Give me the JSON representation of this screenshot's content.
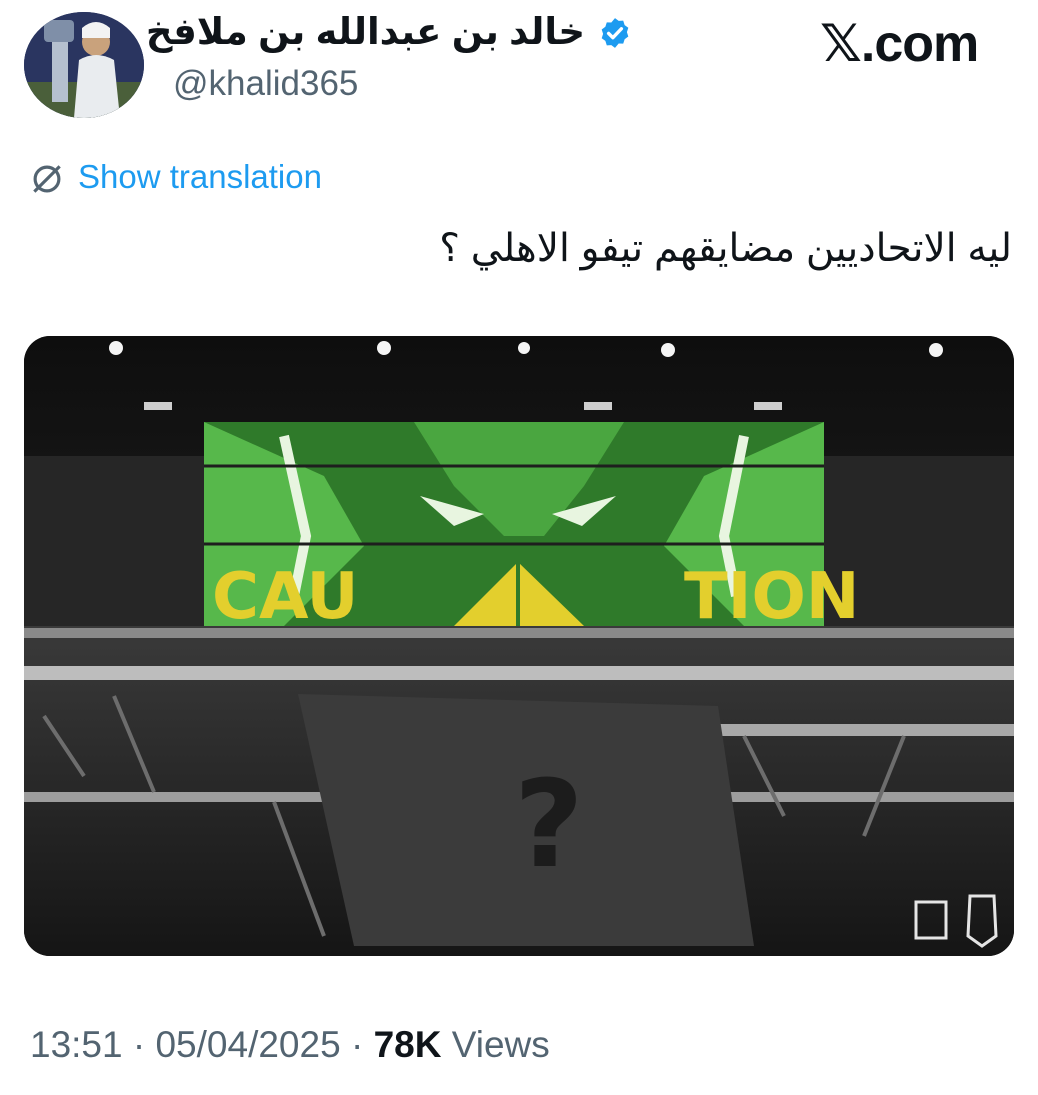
{
  "author": {
    "display_name": "خالد بن عبدالله بن ملافخ",
    "handle": "@khalid365",
    "verified_icon": "verified-badge-icon",
    "avatar_icon": "avatar"
  },
  "brand": {
    "label": "𝕏.com"
  },
  "translation": {
    "label": "Show translation",
    "icon": "globe-icon"
  },
  "tweet": {
    "text": "ليه الاتحاديين مضايقهم تيفو الاهلي ؟"
  },
  "media": {
    "caution_left": "CAU",
    "caution_right": "TION",
    "question_mark": "?"
  },
  "meta": {
    "time": "13:51",
    "separator": "·",
    "date": "05/04/2025",
    "views_count": "78K",
    "views_label": "Views"
  },
  "colors": {
    "accent": "#1d9bf0",
    "tifo_green": "#3fae3a",
    "caution_yellow": "#e3cf2d"
  }
}
